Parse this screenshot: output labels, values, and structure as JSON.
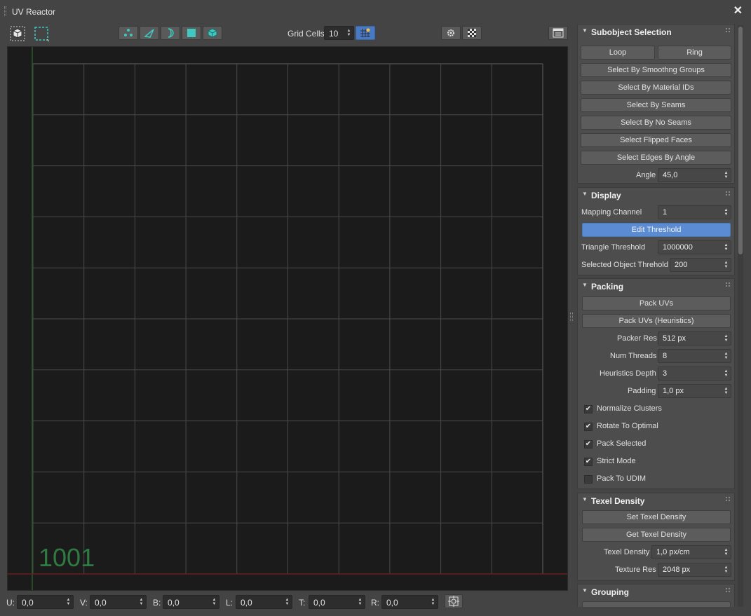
{
  "window": {
    "title": "UV Reactor",
    "close_glyph": "✕"
  },
  "toolbar": {
    "grid_cells_label": "Grid Cells:",
    "grid_cells_value": "10",
    "icons": [
      "cube-select-icon",
      "marquee-select-icon",
      "vertex-mode-icon",
      "edge-mode-icon",
      "border-mode-icon",
      "face-mode-icon",
      "element-mode-icon",
      "grid-snap-icon",
      "settings-gear-icon",
      "checker-icon",
      "panel-toggle-icon"
    ]
  },
  "viewport": {
    "udim_label": "1001",
    "grid_divisions": 10,
    "colors": {
      "grid": "#4a4a4a",
      "u_axis": "#2a5a2a",
      "v_axis": "#6a1e1e",
      "background": "#1b1b1b",
      "udim_text": "#2f7a43"
    }
  },
  "bottombar": {
    "fields": [
      {
        "label": "U:",
        "value": "0,0"
      },
      {
        "label": "V:",
        "value": "0,0"
      },
      {
        "label": "B:",
        "value": "0,0"
      },
      {
        "label": "L:",
        "value": "0,0"
      },
      {
        "label": "T:",
        "value": "0,0"
      },
      {
        "label": "R:",
        "value": "0,0"
      }
    ]
  },
  "panel": {
    "subobject": {
      "title": "Subobject Selection",
      "loop": "Loop",
      "ring": "Ring",
      "by_smoothing": "Select By Smoothng Groups",
      "by_material": "Select By Material IDs",
      "by_seams": "Select By Seams",
      "by_no_seams": "Select By No Seams",
      "flipped": "Select Flipped Faces",
      "edges_by_angle": "Select Edges By Angle",
      "angle_label": "Angle",
      "angle_value": "45,0"
    },
    "display": {
      "title": "Display",
      "mapping_label": "Mapping Channel",
      "mapping_value": "1",
      "edit_threshold": "Edit Threshold",
      "triangle_label": "Triangle Threshold",
      "triangle_value": "1000000",
      "selobj_label": "Selected Object Threhold",
      "selobj_value": "200"
    },
    "packing": {
      "title": "Packing",
      "pack_uvs": "Pack UVs",
      "pack_heuristics": "Pack UVs (Heuristics)",
      "packer_res_label": "Packer Res",
      "packer_res_value": "512 px",
      "threads_label": "Num Threads",
      "threads_value": "8",
      "depth_label": "Heuristics Depth",
      "depth_value": "3",
      "padding_label": "Padding",
      "padding_value": "1,0 px",
      "checks": [
        {
          "label": "Normalize Clusters",
          "checked": true
        },
        {
          "label": "Rotate To Optimal",
          "checked": true
        },
        {
          "label": "Pack Selected",
          "checked": true
        },
        {
          "label": "Strict Mode",
          "checked": true
        },
        {
          "label": "Pack To UDIM",
          "checked": false
        }
      ],
      "check_glyph": "✔"
    },
    "texel": {
      "title": "Texel Density",
      "set": "Set Texel Density",
      "get": "Get Texel Density",
      "density_label": "Texel Density",
      "density_value": "1,0 px/cm",
      "texres_label": "Texture Res",
      "texres_value": "2048 px"
    },
    "grouping": {
      "title": "Grouping"
    }
  },
  "colors": {
    "accent": "#5b8cd3",
    "teal_icon": "#3fc7c0",
    "active_toolbar": "#4a79c4"
  }
}
